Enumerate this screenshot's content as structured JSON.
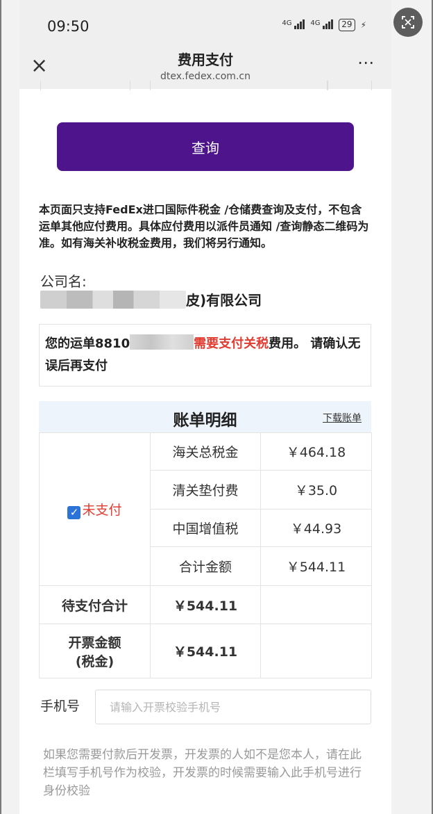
{
  "status_bar": {
    "time": "09:50",
    "net1": "4G",
    "net2": "4G",
    "battery": "29"
  },
  "header": {
    "title": "费用支付",
    "url": "dtex.fedex.com.cn",
    "close_icon": "×",
    "more_icon": "⋯"
  },
  "query_button": "查询",
  "notice": "本页面只支持FedEx进口国际件税金 /仓储费查询及支付，不包含运单其他应付费用。具体应付费用以派件员通知 /查询静态二维码为准。如有海关补收税金费用，我们将另行通知。",
  "company": {
    "label": "公司名:",
    "name_suffix": "皮)有限公司"
  },
  "waybill": {
    "prefix": "您的运单8810",
    "highlight": "需要支付关税",
    "suffix": "费用。 请确认无误后再支付"
  },
  "bill": {
    "title": "账单明细",
    "download": "下载账单",
    "status_label": "未支付",
    "items": [
      {
        "label": "海关总税金",
        "value": "￥464.18"
      },
      {
        "label": "清关垫付费",
        "value": "￥35.0"
      },
      {
        "label": "中国增值税",
        "value": "￥44.93"
      }
    ],
    "total_label": "合计金额",
    "total_value": "￥544.11",
    "pending_label": "待支付合计",
    "pending_value": "￥544.11",
    "invoice_label_line1": "开票金额",
    "invoice_label_line2": "(税金)",
    "invoice_value": "￥544.11"
  },
  "phone": {
    "label": "手机号",
    "placeholder": "请输入开票校验手机号"
  },
  "tip": "如果您需要付款后开发票，开发票的人如不是您本人，请在此栏填写手机号作为校验，开发票的时候需要输入此手机号进行身份校验",
  "icons": {
    "float": "scan-icon",
    "close": "close-icon",
    "more": "more-icon",
    "checkbox": "checkbox-checked-icon"
  },
  "colors": {
    "brand_purple": "#4d148c",
    "alert_red": "#e03c31",
    "check_blue": "#2b73d6"
  }
}
